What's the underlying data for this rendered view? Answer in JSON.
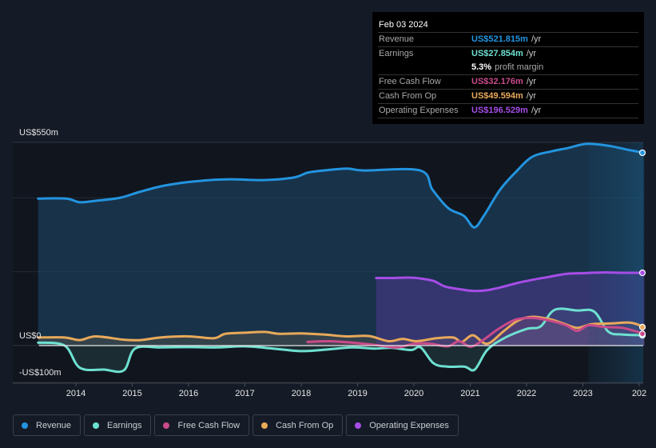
{
  "tooltip": {
    "date": "Feb 03 2024",
    "rows": [
      {
        "label": "Revenue",
        "value": "US$521.815m",
        "unit": "/yr",
        "color": "#2394df"
      },
      {
        "label": "Earnings",
        "value": "US$27.854m",
        "unit": "/yr",
        "color": "#6ee0d0"
      },
      {
        "label": "",
        "value": "5.3%",
        "unit": "profit margin",
        "color": "#ffffff"
      },
      {
        "label": "Free Cash Flow",
        "value": "US$32.176m",
        "unit": "/yr",
        "color": "#c94b8a"
      },
      {
        "label": "Cash From Op",
        "value": "US$49.594m",
        "unit": "/yr",
        "color": "#e8a95a"
      },
      {
        "label": "Operating Expenses",
        "value": "US$196.529m",
        "unit": "/yr",
        "color": "#a64de6"
      }
    ]
  },
  "legend": [
    {
      "label": "Revenue",
      "color": "#2394df"
    },
    {
      "label": "Earnings",
      "color": "#6ee0d0"
    },
    {
      "label": "Free Cash Flow",
      "color": "#c94b8a"
    },
    {
      "label": "Cash From Op",
      "color": "#e8a95a"
    },
    {
      "label": "Operating Expenses",
      "color": "#a64de6"
    }
  ],
  "chart_data": {
    "type": "line",
    "title": "",
    "xlabel": "",
    "ylabel": "",
    "y_tick_labels": [
      "US$550m",
      "US$0",
      "-US$100m"
    ],
    "y_ticks": [
      550,
      0,
      -100
    ],
    "ylim": [
      -100,
      550
    ],
    "x_tick_labels": [
      "2014",
      "2015",
      "2016",
      "2017",
      "2018",
      "2019",
      "2020",
      "2021",
      "2022",
      "2023",
      "202"
    ],
    "x_ticks": [
      2014,
      2015,
      2016,
      2017,
      2018,
      2019,
      2020,
      2021,
      2022,
      2023,
      2024
    ],
    "xlim": [
      2013.33,
      2024.1
    ],
    "grid": true,
    "legend_position": "bottom",
    "forecast_region_start": 2023.1,
    "series": [
      {
        "name": "Revenue",
        "color": "#2394df",
        "x": [
          2013.33,
          2013.83,
          2014.07,
          2014.35,
          2014.78,
          2015.13,
          2015.57,
          2016.07,
          2016.7,
          2017.33,
          2017.87,
          2018.11,
          2018.4,
          2018.82,
          2019.11,
          2020.11,
          2020.33,
          2020.61,
          2020.89,
          2021.07,
          2021.24,
          2021.53,
          2021.81,
          2022.1,
          2022.45,
          2022.74,
          2023.06,
          2023.45,
          2023.8,
          2024.09
        ],
        "y": [
          398,
          398,
          388,
          392,
          400,
          416,
          433,
          444,
          450,
          448,
          455,
          468,
          474,
          479,
          474,
          474,
          422,
          372,
          351,
          320,
          351,
          422,
          470,
          511,
          526,
          535,
          546,
          541,
          530,
          522
        ]
      },
      {
        "name": "Earnings",
        "color": "#6ee0d0",
        "x": [
          2013.33,
          2013.8,
          2014.07,
          2014.5,
          2014.85,
          2015.05,
          2015.5,
          2016.0,
          2016.5,
          2017.0,
          2017.5,
          2018.0,
          2018.5,
          2018.9,
          2019.3,
          2019.6,
          2019.95,
          2020.12,
          2020.35,
          2020.6,
          2020.9,
          2021.08,
          2021.3,
          2021.6,
          2022.0,
          2022.25,
          2022.5,
          2022.9,
          2023.2,
          2023.45,
          2023.7,
          2024.09
        ],
        "y": [
          8,
          0,
          -60,
          -65,
          -67,
          -8,
          -5,
          -4,
          -5,
          -2,
          -8,
          -15,
          -10,
          -5,
          -8,
          -6,
          -12,
          -5,
          -48,
          -57,
          -57,
          -65,
          -12,
          20,
          45,
          52,
          97,
          95,
          92,
          38,
          30,
          28
        ]
      },
      {
        "name": "Free Cash Flow",
        "color": "#c94b8a",
        "x": [
          2018.11,
          2018.5,
          2018.9,
          2019.3,
          2019.7,
          2020.0,
          2020.3,
          2020.6,
          2020.8,
          2021.0,
          2021.2,
          2021.5,
          2021.8,
          2022.1,
          2022.4,
          2022.7,
          2022.9,
          2023.1,
          2023.4,
          2023.7,
          2024.09
        ],
        "y": [
          10,
          12,
          8,
          2,
          -5,
          5,
          5,
          -2,
          12,
          -3,
          12,
          45,
          70,
          75,
          68,
          55,
          40,
          55,
          50,
          48,
          32
        ]
      },
      {
        "name": "Cash From Op",
        "color": "#e8a95a",
        "x": [
          2013.33,
          2013.8,
          2014.07,
          2014.35,
          2014.85,
          2015.15,
          2015.5,
          2016.0,
          2016.45,
          2016.65,
          2017.0,
          2017.35,
          2017.6,
          2018.0,
          2018.4,
          2018.8,
          2019.2,
          2019.55,
          2019.8,
          2020.05,
          2020.4,
          2020.7,
          2020.85,
          2021.05,
          2021.3,
          2021.6,
          2021.85,
          2022.1,
          2022.4,
          2022.65,
          2022.9,
          2023.15,
          2023.5,
          2023.85,
          2024.09
        ],
        "y": [
          22,
          22,
          15,
          25,
          16,
          15,
          22,
          25,
          20,
          32,
          35,
          37,
          32,
          33,
          30,
          25,
          26,
          12,
          18,
          12,
          20,
          22,
          10,
          28,
          5,
          40,
          68,
          78,
          72,
          60,
          48,
          58,
          60,
          62,
          50
        ]
      },
      {
        "name": "Operating Expenses",
        "color": "#a64de6",
        "x": [
          2019.33,
          2019.6,
          2019.9,
          2020.1,
          2020.35,
          2020.55,
          2020.8,
          2021.05,
          2021.3,
          2021.6,
          2021.85,
          2022.1,
          2022.4,
          2022.7,
          2023.0,
          2023.4,
          2023.7,
          2024.09
        ],
        "y": [
          183,
          183,
          184,
          182,
          175,
          160,
          153,
          148,
          150,
          160,
          170,
          178,
          186,
          194,
          196,
          198,
          197,
          197
        ]
      }
    ]
  }
}
